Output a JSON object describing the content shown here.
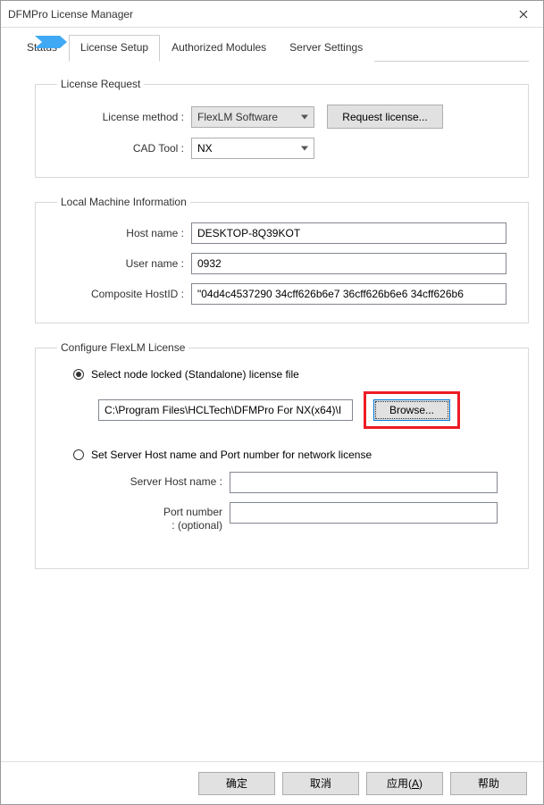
{
  "window": {
    "title": "DFMPro License Manager"
  },
  "tabs": {
    "status": "Status",
    "license_setup": "License Setup",
    "authorized_modules": "Authorized Modules",
    "server_settings": "Server Settings"
  },
  "license_request": {
    "legend": "License Request",
    "method_label": "License method :",
    "method_value": "FlexLM Software",
    "cad_label": "CAD Tool :",
    "cad_value": "NX",
    "request_btn": "Request license..."
  },
  "local_machine": {
    "legend": "Local Machine Information",
    "host_label": "Host name :",
    "host_value": "DESKTOP-8Q39KOT",
    "user_label": "User name :",
    "user_value": "0932",
    "hostid_label": "Composite HostID :",
    "hostid_value": "\"04d4c4537290 34cff626b6e7 36cff626b6e6 34cff626b6"
  },
  "flexlm": {
    "legend": "Configure FlexLM License",
    "radio1": "Select node locked (Standalone) license file",
    "path_value": "C:\\Program Files\\HCLTech\\DFMPro For NX(x64)\\I",
    "browse_btn": "Browse...",
    "radio2": "Set Server Host name and Port number for network license",
    "server_host_label": "Server Host name :",
    "server_host_value": "",
    "port_label_line1": "Port number",
    "port_label_line2": ": (optional)",
    "port_value": ""
  },
  "footer": {
    "ok": "确定",
    "cancel": "取消",
    "apply_pre": "应用(",
    "apply_u": "A",
    "apply_post": ")",
    "help": "帮助"
  }
}
